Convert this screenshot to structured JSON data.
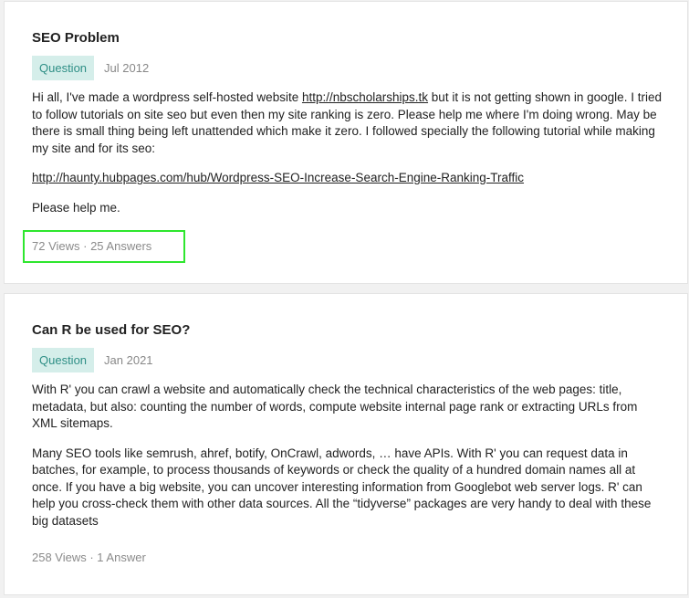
{
  "posts": [
    {
      "title": "SEO Problem",
      "badge": "Question",
      "date": "Jul 2012",
      "para1_pre": "Hi all, I've made a wordpress self-hosted website ",
      "para1_link": "http://nbscholarships.tk",
      "para1_post": " but it is not getting shown in google. I tried to follow tutorials on site seo but even then my site ranking is zero. Please help me where I'm doing wrong. May be there is small thing being left unattended which make it zero. I followed specially the following tutorial while making my site and for its seo:",
      "para2_link": "http://haunty.hubpages.com/hub/Wordpress-SEO-Increase-Search-Engine-Ranking-Traffic",
      "para3": "Please help me.",
      "stats": "72 Views · 25 Answers"
    },
    {
      "title": "Can R be used for SEO?",
      "badge": "Question",
      "date": "Jan 2021",
      "para1": "With R' you can crawl a website and automatically check the technical characteristics of the web pages: title, metadata, but also: counting the number of words, compute website internal page rank or extracting URLs from XML sitemaps.",
      "para2": "Many SEO tools like semrush, ahref, botify, OnCrawl, adwords, … have APIs. With R' you can request data in batches, for example, to process thousands of keywords or check the quality of a hundred domain names all at once. If you have a big website, you can uncover interesting information from Googlebot web server logs. R' can help you cross-check them with other data sources. All the “tidyverse” packages are very handy to deal with these big datasets",
      "stats": "258 Views · 1 Answer"
    }
  ],
  "colors": {
    "badge_bg": "#d5eeea",
    "badge_text": "#2f8f86",
    "highlight": "#2ee62e"
  }
}
